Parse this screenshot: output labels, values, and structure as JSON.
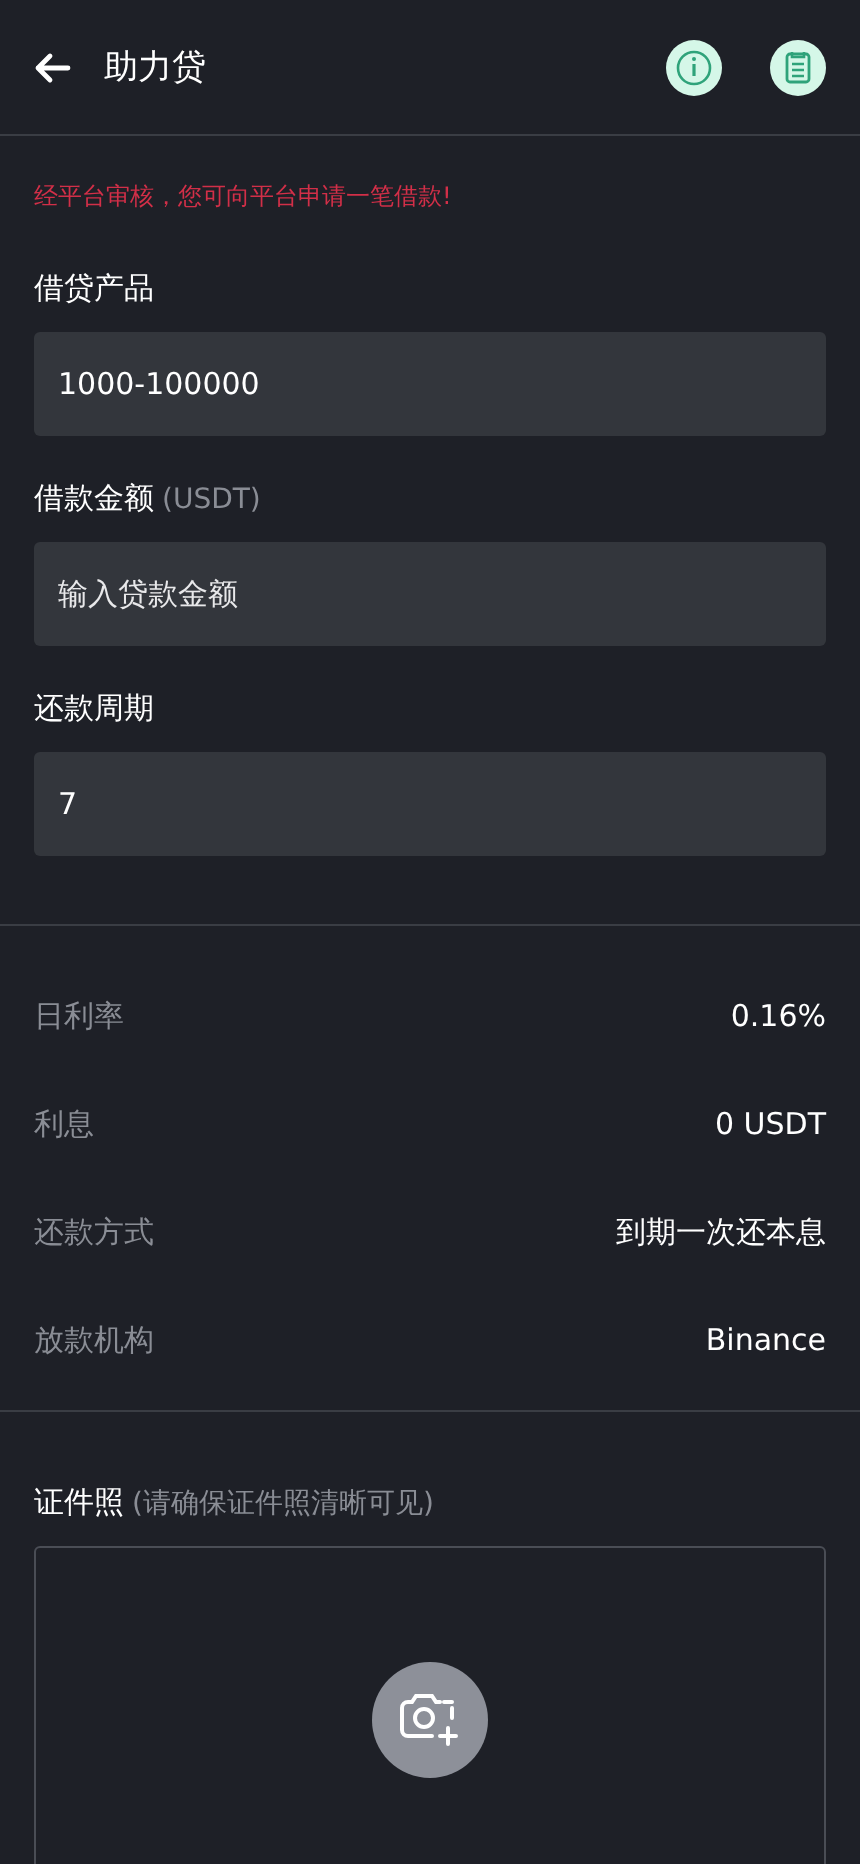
{
  "header": {
    "title": "助力贷"
  },
  "notice": "经平台审核，您可向平台申请一笔借款!",
  "fields": [
    {
      "label": "借贷产品",
      "value": "1000-100000"
    },
    {
      "label": "借款金额",
      "unit": "(USDT)",
      "placeholder": "输入贷款金额"
    },
    {
      "label": "还款周期",
      "value": "7"
    }
  ],
  "details": [
    {
      "label": "日利率",
      "value": "0.16%"
    },
    {
      "label": "利息",
      "value": "0 USDT"
    },
    {
      "label": "还款方式",
      "value": "到期一次还本息"
    },
    {
      "label": "放款机构",
      "value": "Binance"
    }
  ],
  "upload": {
    "label": "证件照",
    "hint": "(请确保证件照清晰可见)"
  }
}
